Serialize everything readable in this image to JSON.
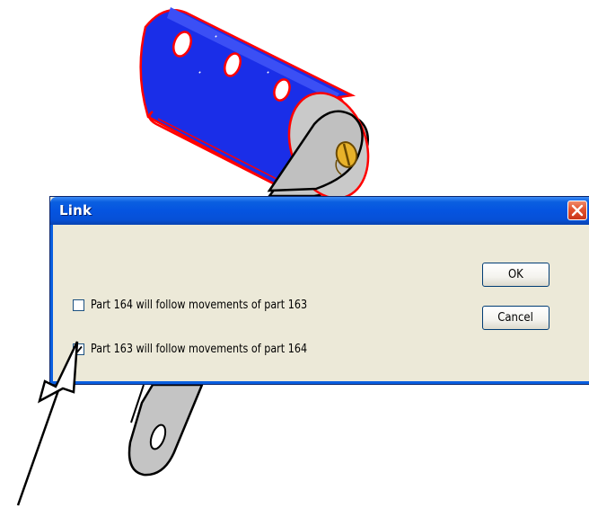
{
  "dialog": {
    "title": "Link",
    "options": [
      {
        "label": "Part 164 will follow movements of part 163",
        "checked": false
      },
      {
        "label": "Part 163 will follow movements of part 164",
        "checked": true
      }
    ],
    "ok_label": "OK",
    "cancel_label": "Cancel"
  },
  "colors": {
    "title_bar": "#0554e0",
    "dialog_bg": "#ece9d8",
    "part_body": "#1a2ee8",
    "part_edges": "#ff0000",
    "screw": "#e8b22a"
  },
  "icons": {
    "close": "close-icon",
    "check": "checkmark-icon",
    "callout": "arrow-icon"
  }
}
